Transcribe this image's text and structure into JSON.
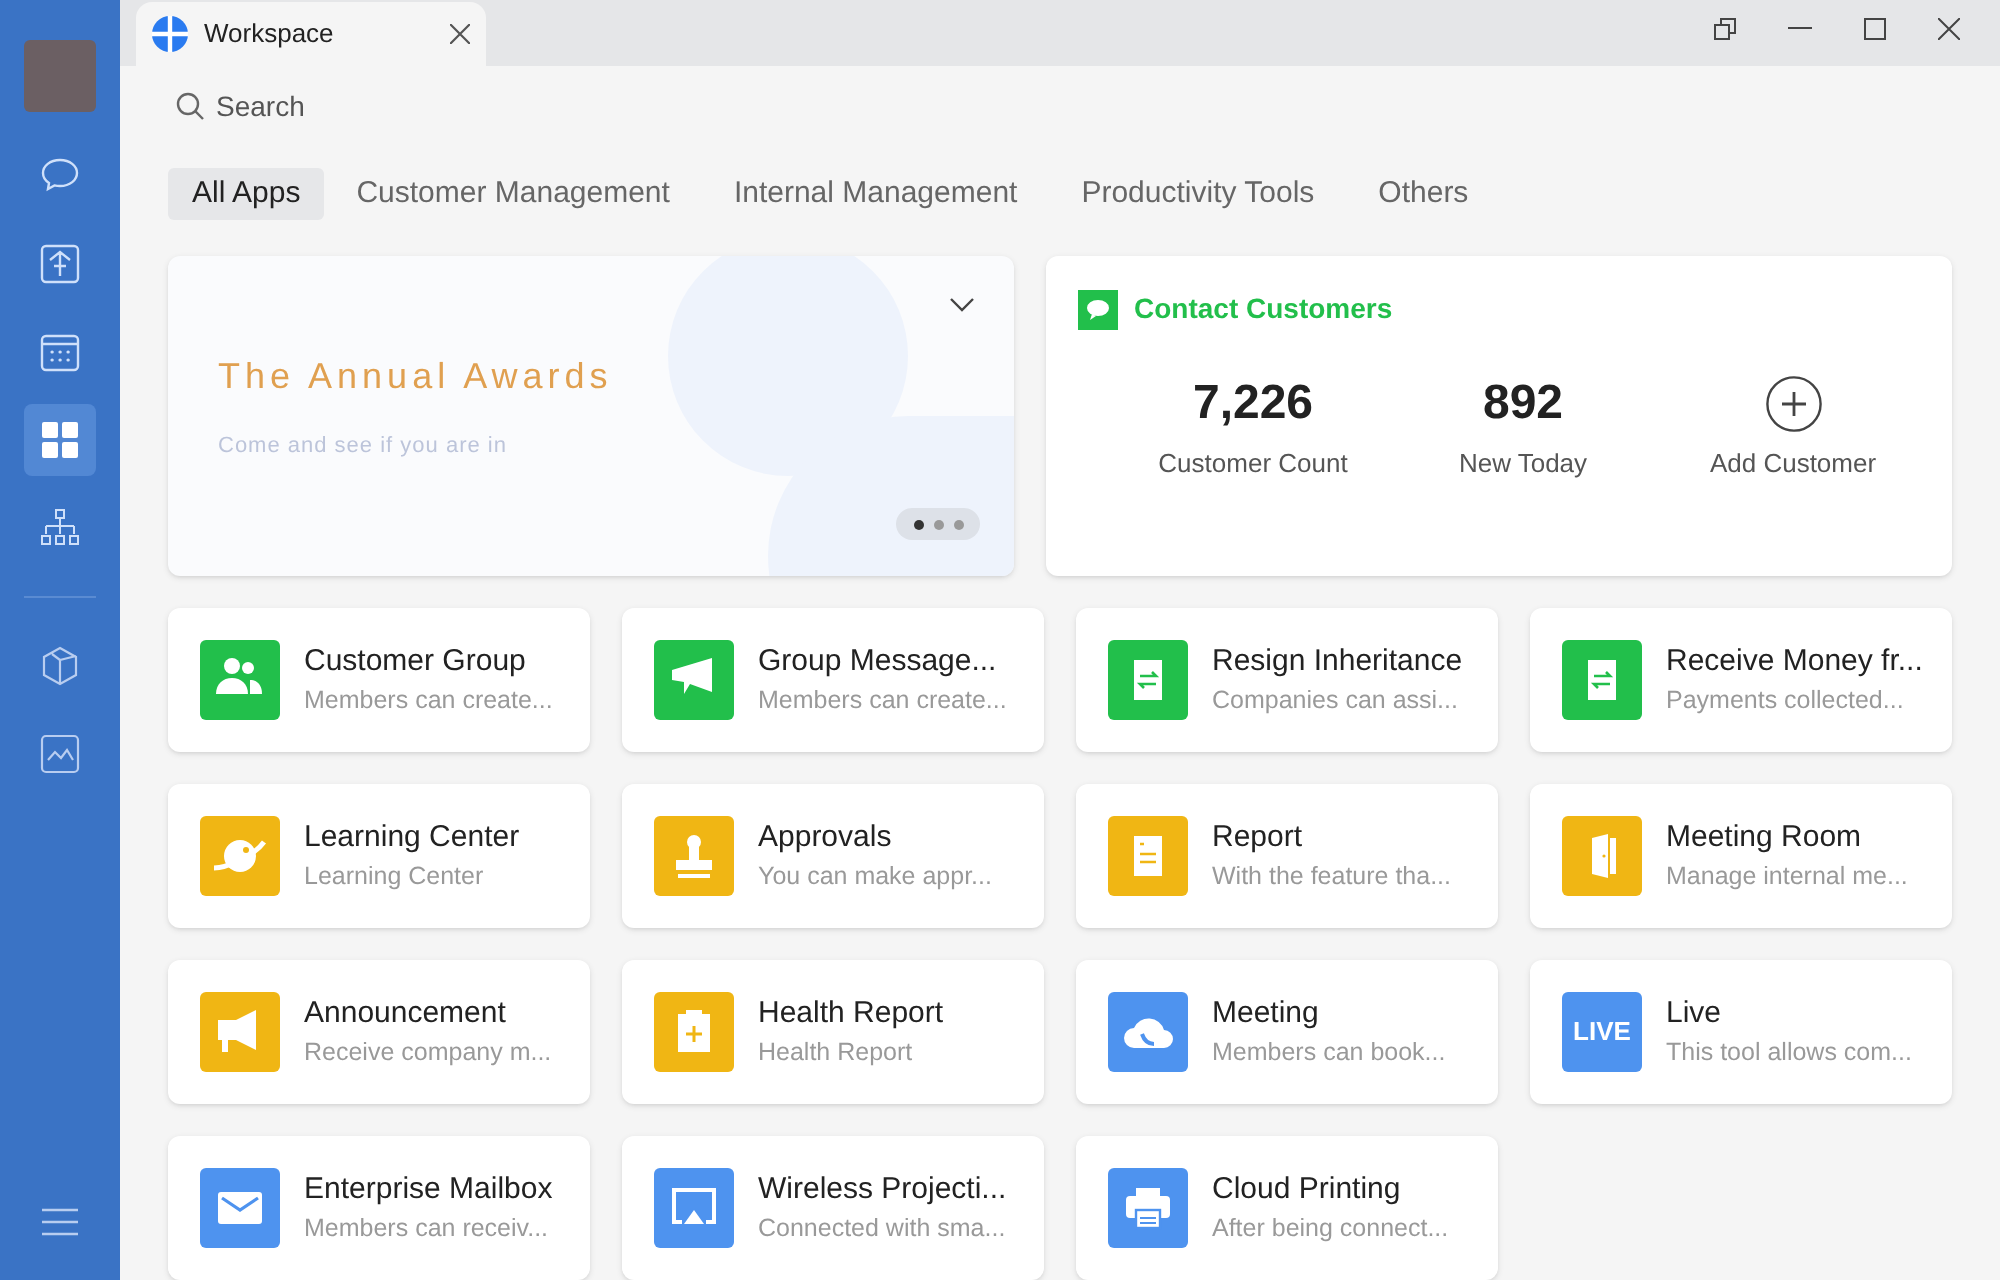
{
  "sidebar": {
    "items": [
      {
        "kind": "chat",
        "selected": false
      },
      {
        "kind": "upload",
        "selected": false
      },
      {
        "kind": "calendar",
        "selected": false
      },
      {
        "kind": "grid",
        "selected": true
      },
      {
        "kind": "org",
        "selected": false
      },
      {
        "kind": "cube",
        "selected": false
      },
      {
        "kind": "mountain",
        "selected": false
      }
    ]
  },
  "window": {
    "tab_title": "Workspace"
  },
  "search": {
    "placeholder": "Search"
  },
  "categories": [
    {
      "label": "All Apps",
      "selected": true
    },
    {
      "label": "Customer Management",
      "selected": false
    },
    {
      "label": "Internal Management",
      "selected": false
    },
    {
      "label": "Productivity Tools",
      "selected": false
    },
    {
      "label": "Others",
      "selected": false
    }
  ],
  "banner": {
    "title": "The Annual Awards",
    "subtitle": "Come and see if you are in",
    "pages": [
      {
        "selected": true
      },
      {
        "selected": false
      },
      {
        "selected": false
      }
    ]
  },
  "contact": {
    "title": "Contact Customers",
    "stats": [
      {
        "kind": "number",
        "value": "7,226",
        "label": "Customer Count"
      },
      {
        "kind": "number",
        "value": "892",
        "label": "New Today"
      },
      {
        "kind": "action",
        "label": "Add Customer"
      }
    ]
  },
  "apps": [
    {
      "name": "Customer Group",
      "desc": "Members can create...",
      "color": "#22bf4b",
      "kind": "people"
    },
    {
      "name": "Group Message...",
      "desc": "Members can create...",
      "color": "#22bf4b",
      "kind": "flag"
    },
    {
      "name": "Resign Inheritance",
      "desc": "Companies can assi...",
      "color": "#22bf4b",
      "kind": "swapdoc"
    },
    {
      "name": "Receive Money fr...",
      "desc": "Payments collected...",
      "color": "#22bf4b",
      "kind": "swapdoc"
    },
    {
      "name": "Learning Center",
      "desc": "Learning Center",
      "color": "#f0b614",
      "kind": "planet"
    },
    {
      "name": "Approvals",
      "desc": "You can make appr...",
      "color": "#f0b614",
      "kind": "stamp"
    },
    {
      "name": "Report",
      "desc": "With the feature tha...",
      "color": "#f0b614",
      "kind": "doc"
    },
    {
      "name": "Meeting Room",
      "desc": "Manage internal me...",
      "color": "#f0b614",
      "kind": "door"
    },
    {
      "name": "Announcement",
      "desc": "Receive company m...",
      "color": "#f0b614",
      "kind": "megaphone"
    },
    {
      "name": "Health Report",
      "desc": "Health Report",
      "color": "#f0b614",
      "kind": "clipboard"
    },
    {
      "name": "Meeting",
      "desc": "Members can book...",
      "color": "#4e93ef",
      "kind": "cloud"
    },
    {
      "name": "Live",
      "desc": "This tool allows com...",
      "color": "#4e93ef",
      "kind": "live",
      "badge": "LIVE"
    },
    {
      "name": "Enterprise Mailbox",
      "desc": "Members can receiv...",
      "color": "#4e93ef",
      "kind": "mail"
    },
    {
      "name": "Wireless Projecti...",
      "desc": "Connected with sma...",
      "color": "#4e93ef",
      "kind": "cast"
    },
    {
      "name": "Cloud Printing",
      "desc": "After being connect...",
      "color": "#4e93ef",
      "kind": "printer"
    }
  ]
}
